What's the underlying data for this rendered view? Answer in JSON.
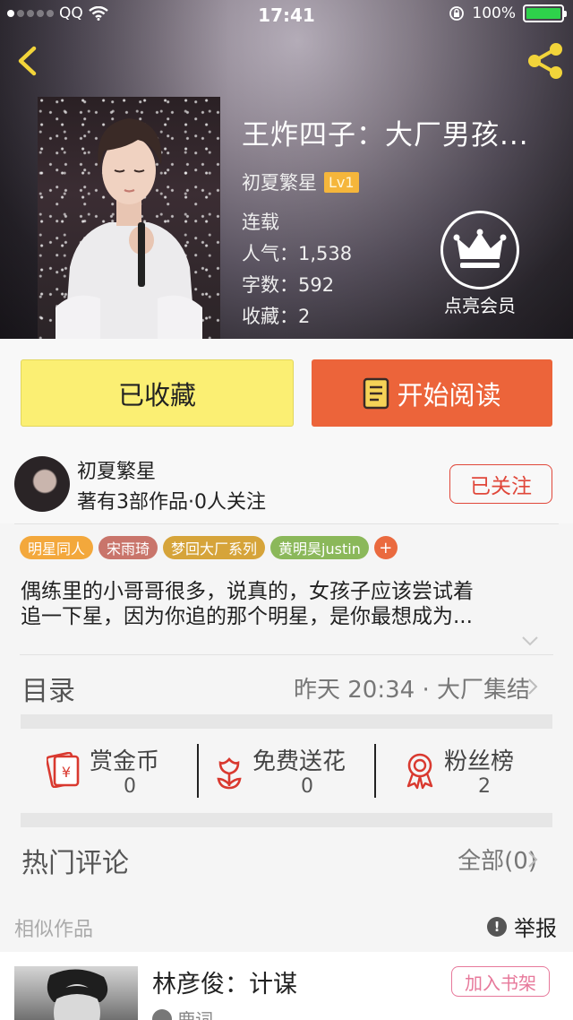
{
  "status_bar": {
    "carrier": "QQ",
    "time": "17:41",
    "battery_percent": "100%",
    "battery_level": 1.0
  },
  "book": {
    "title": "王炸四子：大厂男孩...",
    "author": "初夏繁星",
    "level_badge": "Lv1",
    "status": "连载",
    "popularity_label": "人气：",
    "popularity_value": "1,538",
    "word_count_label": "字数：",
    "word_count_value": "592",
    "favorites_label": "收藏：",
    "favorites_value": "2",
    "vip_label": "点亮会员"
  },
  "actions": {
    "favorite_label": "已收藏",
    "read_label": "开始阅读"
  },
  "author_card": {
    "name": "初夏繁星",
    "stats": "著有3部作品·0人关注",
    "follow_label": "已关注"
  },
  "tags": [
    {
      "label": "明星同人",
      "color": "#f3a83c"
    },
    {
      "label": "宋雨琦",
      "color": "#c9756b"
    },
    {
      "label": "梦回大厂系列",
      "color": "#d6a43a"
    },
    {
      "label": "黄明昊justin",
      "color": "#8bb85a"
    }
  ],
  "tag_more": "+",
  "description": {
    "line1": "偶练里的小哥哥很多，说真的，女孩子应该尝试着",
    "line2": "追一下星，因为你追的那个明星，是你最想成为..."
  },
  "catalog": {
    "title": "目录",
    "latest": "昨天 20:34 · 大厂集结"
  },
  "stats": [
    {
      "label": "赏金币",
      "value": "0",
      "icon": "red-envelope-icon"
    },
    {
      "label": "免费送花",
      "value": "0",
      "icon": "flower-icon"
    },
    {
      "label": "粉丝榜",
      "value": "2",
      "icon": "medal-icon"
    }
  ],
  "comments": {
    "title": "热门评论",
    "all_label": "全部(0)"
  },
  "similar": {
    "title": "相似作品",
    "report_label": "举报",
    "report_icon_glyph": "!",
    "items": [
      {
        "title": "林彦俊：计谋",
        "author": "鹿词",
        "add_label": "加入书架"
      }
    ]
  },
  "colors": {
    "accent_orange": "#ec643a",
    "favorite_yellow": "#fbef73",
    "follow_red": "#e0473a",
    "icon_red": "#d9392f",
    "share_yellow": "#f2d43a"
  }
}
